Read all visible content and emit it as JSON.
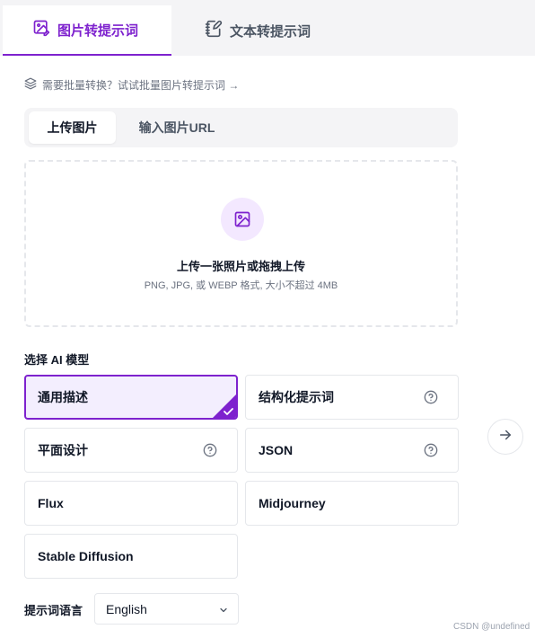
{
  "main_tabs": [
    {
      "label": "图片转提示词",
      "icon": "image-edit-icon",
      "active": true
    },
    {
      "label": "文本转提示词",
      "icon": "notebook-pen-icon",
      "active": false
    }
  ],
  "batch_hint": {
    "text": "需要批量转换？试试批量图片转提示词 →",
    "icon": "layers-icon"
  },
  "upload_tabs": [
    {
      "label": "上传图片",
      "active": true
    },
    {
      "label": "输入图片URL",
      "active": false
    }
  ],
  "dropzone": {
    "icon": "image-icon",
    "title": "上传一张照片或拖拽上传",
    "subtitle": "PNG, JPG, 或 WEBP 格式, 大小不超过 4MB"
  },
  "models": {
    "label": "选择 AI 模型",
    "items": [
      {
        "label": "通用描述",
        "selected": true,
        "help": false
      },
      {
        "label": "结构化提示词",
        "selected": false,
        "help": true
      },
      {
        "label": "平面设计",
        "selected": false,
        "help": true
      },
      {
        "label": "JSON",
        "selected": false,
        "help": true
      },
      {
        "label": "Flux",
        "selected": false,
        "help": false
      },
      {
        "label": "Midjourney",
        "selected": false,
        "help": false
      },
      {
        "label": "Stable Diffusion",
        "selected": false,
        "help": false
      }
    ]
  },
  "next_icon": "arrow-right-icon",
  "language": {
    "label": "提示词语言",
    "value": "English",
    "icon": "chevron-down-icon"
  },
  "watermark": "CSDN @undefined",
  "colors": {
    "accent": "#7e22ce",
    "accent_light": "#f3e8ff",
    "border": "#e5e7eb"
  }
}
